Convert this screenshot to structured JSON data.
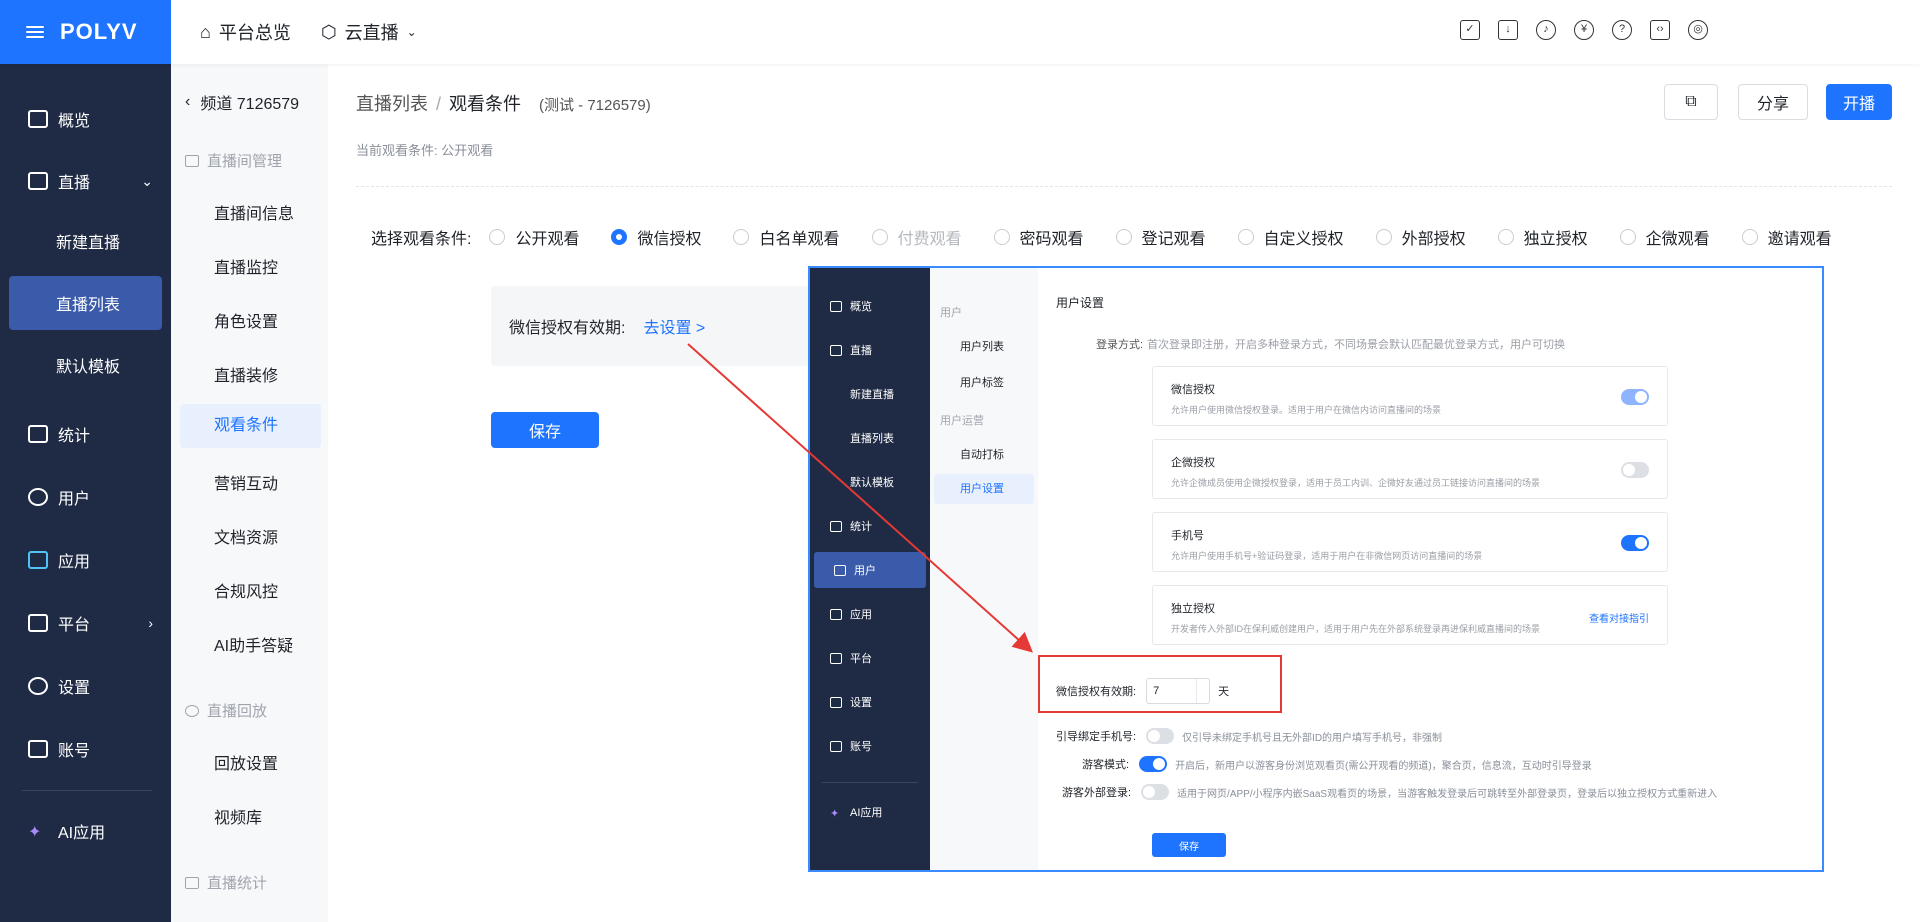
{
  "brand": {
    "logo": "POLYV"
  },
  "topnav": {
    "home": "平台总览",
    "live": "云直播"
  },
  "leftnav": {
    "items": [
      {
        "label": "概览"
      },
      {
        "label": "直播"
      },
      {
        "label": "新建直播"
      },
      {
        "label": "直播列表"
      },
      {
        "label": "默认模板"
      },
      {
        "label": "统计"
      },
      {
        "label": "用户"
      },
      {
        "label": "应用"
      },
      {
        "label": "平台"
      },
      {
        "label": "设置"
      },
      {
        "label": "账号"
      },
      {
        "label": "AI应用"
      }
    ]
  },
  "secnav": {
    "back": "频道 7126579",
    "group1": "直播间管理",
    "items1": [
      "直播间信息",
      "直播监控",
      "角色设置",
      "直播装修",
      "观看条件",
      "营销互动",
      "文档资源",
      "合规风控",
      "AI助手答疑"
    ],
    "group2": "直播回放",
    "items2": [
      "回放设置",
      "视频库"
    ],
    "group3": "直播统计"
  },
  "main": {
    "crumb1": "直播列表",
    "crumb_sep": "/",
    "crumb2": "观看条件",
    "crumb_note": "(测试 - 7126579)",
    "current": "当前观看条件: 公开观看",
    "share": "分享",
    "start": "开播",
    "cond_label": "选择观看条件:",
    "conditions": [
      "公开观看",
      "微信授权",
      "白名单观看",
      "付费观看",
      "密码观看",
      "登记观看",
      "自定义授权",
      "外部授权",
      "独立授权",
      "企微观看",
      "邀请观看"
    ],
    "validity_label": "微信授权有效期:",
    "validity_link": "去设置 >",
    "save": "保存"
  },
  "inset": {
    "left": [
      "概览",
      "直播",
      "新建直播",
      "直播列表",
      "默认模板",
      "统计",
      "用户",
      "应用",
      "平台",
      "设置",
      "账号",
      "AI应用"
    ],
    "sec_group1": "用户",
    "sec_items1": [
      "用户列表",
      "用户标签"
    ],
    "sec_group2": "用户运营",
    "sec_items2": [
      "自动打标",
      "用户设置"
    ],
    "title": "用户设置",
    "login_label": "登录方式:",
    "login_desc": "首次登录即注册，开启多种登录方式，不同场景会默认匹配最优登录方式，用户可切换",
    "cards": [
      {
        "t": "微信授权",
        "d": "允许用户使用微信授权登录。适用于用户在微信内访问直播间的场景"
      },
      {
        "t": "企微授权",
        "d": "允许企微成员使用企微授权登录，适用于员工内训、企微好友通过员工链接访问直播间的场景"
      },
      {
        "t": "手机号",
        "d": "允许用户使用手机号+验证码登录，适用于用户在非微信网页访问直播间的场景"
      },
      {
        "t": "独立授权",
        "d": "开发者传入外部ID在保利威创建用户，适用于用户先在外部系统登录再进保利威直播间的场景",
        "link": "查看对接指引"
      }
    ],
    "validity_label": "微信授权有效期:",
    "validity_value": "7",
    "validity_unit": "天",
    "opt1_label": "引导绑定手机号:",
    "opt1_desc": "仅引导未绑定手机号且无外部ID的用户填写手机号，非强制",
    "opt2_label": "游客模式:",
    "opt2_desc": "开启后，新用户以游客身份浏览观看页(需公开观看的频道)，聚合页，信息流，互动时引导登录",
    "opt3_label": "游客外部登录:",
    "opt3_desc": "适用于网页/APP/小程序内嵌SaaS观看页的场景，当游客触发登录后可跳转至外部登录页，登录后以独立授权方式重新进入",
    "save": "保存"
  },
  "colors": {
    "accent": "#1e74ff",
    "nav_bg": "#1f2a44",
    "highlight": "#e53935"
  }
}
